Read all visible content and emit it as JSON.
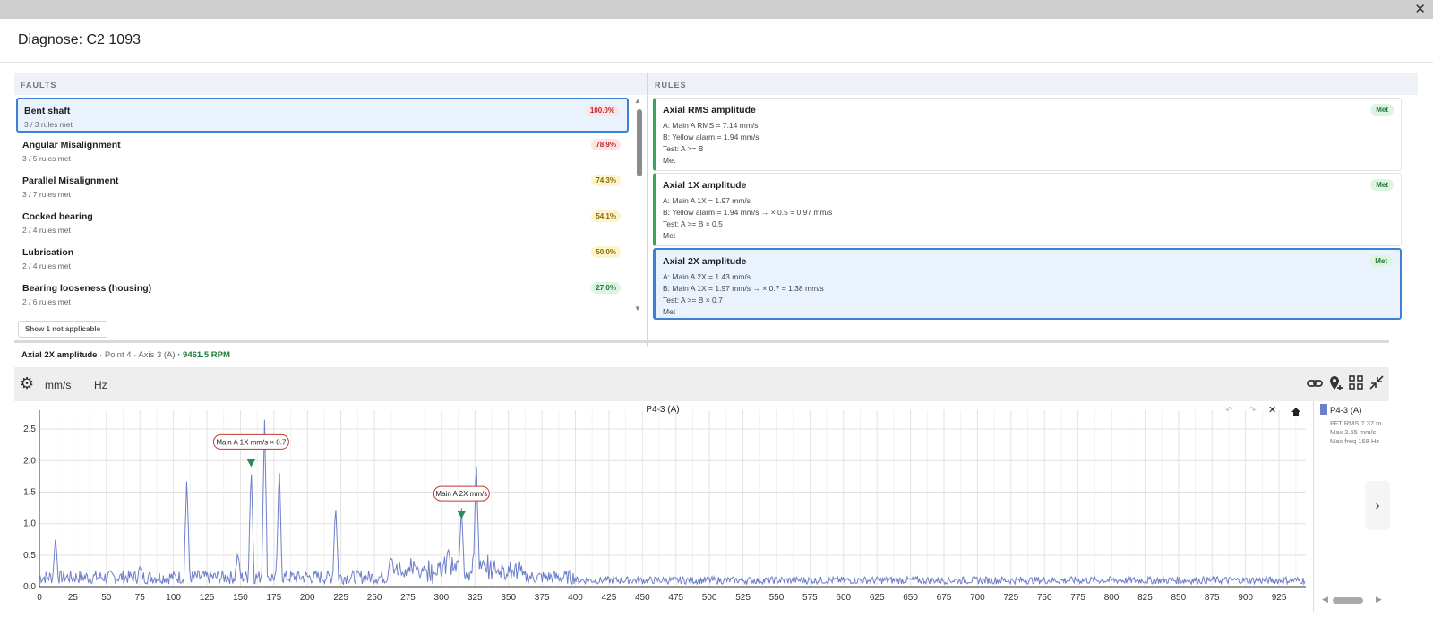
{
  "window": {
    "title": "Diagnose: C2 1093",
    "close_icon": "close-icon"
  },
  "faults": {
    "header": "FAULTS",
    "items": [
      {
        "name": "Bent shaft",
        "sub": "3 / 3 rules met",
        "pct": "100.0%",
        "level": "red",
        "selected": true
      },
      {
        "name": "Angular Misalignment",
        "sub": "3 / 5 rules met",
        "pct": "78.9%",
        "level": "red",
        "selected": false
      },
      {
        "name": "Parallel Misalignment",
        "sub": "3 / 7 rules met",
        "pct": "74.3%",
        "level": "yellow",
        "selected": false
      },
      {
        "name": "Cocked bearing",
        "sub": "2 / 4 rules met",
        "pct": "54.1%",
        "level": "yellow",
        "selected": false
      },
      {
        "name": "Lubrication",
        "sub": "2 / 4 rules met",
        "pct": "50.0%",
        "level": "yellow",
        "selected": false
      },
      {
        "name": "Bearing looseness (housing)",
        "sub": "2 / 6 rules met",
        "pct": "27.0%",
        "level": "green",
        "selected": false
      }
    ],
    "show_button": "Show 1 not applicable"
  },
  "rules": {
    "header": "RULES",
    "items": [
      {
        "title": "Axial RMS amplitude",
        "badge": "Met",
        "lines": [
          "A: Main A RMS = 7.14 mm/s",
          "B: Yellow alarm = 1.94 mm/s",
          "Test: A >= B",
          "Met"
        ],
        "selected": false
      },
      {
        "title": "Axial 1X amplitude",
        "badge": "Met",
        "lines": [
          "A: Main A 1X = 1.97 mm/s",
          "B: Yellow alarm = 1.94 mm/s → × 0.5 = 0.97 mm/s",
          "Test: A >= B × 0.5",
          "Met"
        ],
        "selected": false
      },
      {
        "title": "Axial 2X amplitude",
        "badge": "Met",
        "lines": [
          "A: Main A 2X = 1.43 mm/s",
          "B: Main A 1X = 1.97 mm/s → × 0.7 = 1.38 mm/s",
          "Test: A >= B × 0.7",
          "Met"
        ],
        "selected": true
      }
    ]
  },
  "detail": {
    "rule": "Axial 2X amplitude",
    "location": "· Point 4 · Axis 3 (A)",
    "rpm": "· 9461.5 RPM"
  },
  "toolbar": {
    "unit_amp": "mm/s",
    "unit_freq": "Hz"
  },
  "chart_data": {
    "type": "line",
    "title": "P4-3 (A)",
    "xlim": [
      0,
      945
    ],
    "ylim": [
      0,
      2.8
    ],
    "xticks": [
      0,
      25,
      50,
      75,
      100,
      125,
      150,
      175,
      200,
      225,
      250,
      275,
      300,
      325,
      350,
      375,
      400,
      425,
      450,
      475,
      500,
      525,
      550,
      575,
      600,
      625,
      650,
      675,
      700,
      725,
      750,
      775,
      800,
      825,
      850,
      875,
      900,
      925
    ],
    "yticks": [
      0.0,
      0.5,
      1.0,
      1.5,
      2.0,
      2.5
    ],
    "grid": true,
    "series": [
      {
        "name": "P4-3 (A)",
        "color": "#6c7fc9",
        "peaks": [
          {
            "x": 12,
            "y": 0.78
          },
          {
            "x": 110,
            "y": 1.74
          },
          {
            "x": 158,
            "y": 1.95
          },
          {
            "x": 168,
            "y": 2.65
          },
          {
            "x": 179,
            "y": 1.96
          },
          {
            "x": 221,
            "y": 1.33
          },
          {
            "x": 315,
            "y": 1.25
          },
          {
            "x": 326,
            "y": 2.07
          },
          {
            "x": 305,
            "y": 0.62
          },
          {
            "x": 75,
            "y": 0.32
          },
          {
            "x": 148,
            "y": 0.55
          },
          {
            "x": 262,
            "y": 0.48
          }
        ]
      }
    ],
    "markers": [
      {
        "x": 158,
        "y": 1.97,
        "label": "Main A 1X mm/s × 0.7"
      },
      {
        "x": 315,
        "y": 1.15,
        "label": "Main A 2X mm/s"
      }
    ]
  },
  "legend": {
    "name": "P4-3 (A)",
    "lines": [
      "FFT RMS 7.37 m",
      "Max 2.65 mm/s",
      "Max freq 168 Hz"
    ]
  }
}
